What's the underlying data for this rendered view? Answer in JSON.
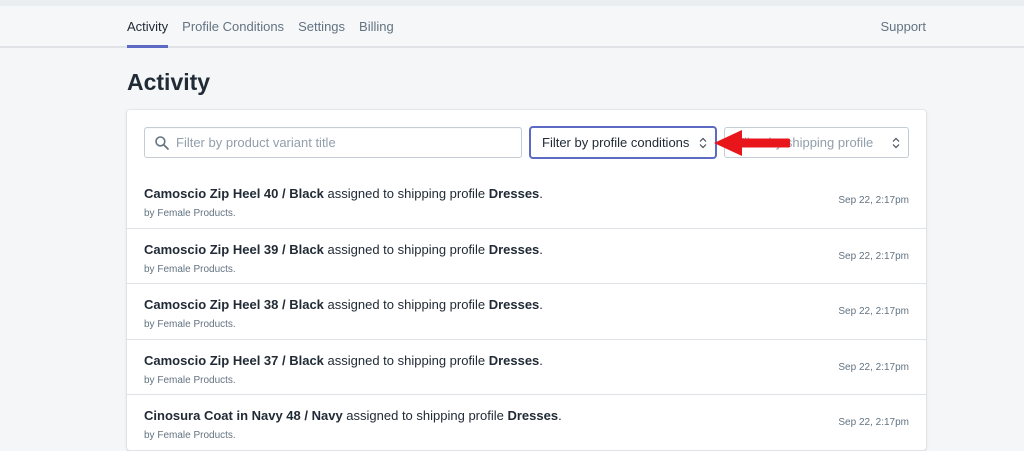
{
  "nav": {
    "tabs": [
      {
        "label": "Activity",
        "active": true
      },
      {
        "label": "Profile Conditions",
        "active": false
      },
      {
        "label": "Settings",
        "active": false
      },
      {
        "label": "Billing",
        "active": false
      }
    ],
    "support_label": "Support"
  },
  "page": {
    "title": "Activity"
  },
  "filters": {
    "search_placeholder": "Filter by product variant title",
    "conditions_label": "Filter by profile conditions",
    "profile_label": "Filter by shipping profile"
  },
  "activity": [
    {
      "product": "Camoscio Zip Heel 40 / Black",
      "middle": " assigned to shipping profile ",
      "profile": "Dresses",
      "suffix": ".",
      "by": "by Female Products.",
      "time": "Sep 22, 2:17pm"
    },
    {
      "product": "Camoscio Zip Heel 39 / Black",
      "middle": " assigned to shipping profile ",
      "profile": "Dresses",
      "suffix": ".",
      "by": "by Female Products.",
      "time": "Sep 22, 2:17pm"
    },
    {
      "product": "Camoscio Zip Heel 38 / Black",
      "middle": " assigned to shipping profile ",
      "profile": "Dresses",
      "suffix": ".",
      "by": "by Female Products.",
      "time": "Sep 22, 2:17pm"
    },
    {
      "product": "Camoscio Zip Heel 37 / Black",
      "middle": " assigned to shipping profile ",
      "profile": "Dresses",
      "suffix": ".",
      "by": "by Female Products.",
      "time": "Sep 22, 2:17pm"
    },
    {
      "product": "Cinosura Coat in Navy 48 / Navy",
      "middle": " assigned to shipping profile ",
      "profile": "Dresses",
      "suffix": ".",
      "by": "by Female Products.",
      "time": "Sep 22, 2:17pm"
    }
  ],
  "colors": {
    "accent": "#5c6ac4",
    "arrow": "#e8161b"
  }
}
